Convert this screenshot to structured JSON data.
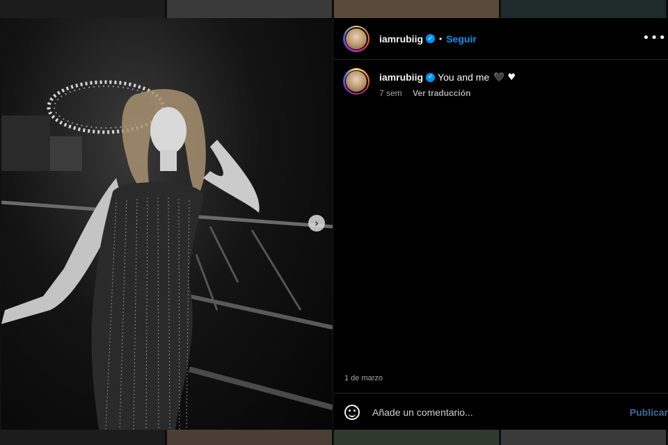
{
  "colors": {
    "accent": "#0095f6",
    "panel_bg": "#000000",
    "muted": "#a8a8a8"
  },
  "post": {
    "username": "iamrubiig",
    "separator": "•",
    "follow_label": "Seguir",
    "more_icon": "more-horizontal-icon",
    "verified_icon": "verified-badge-icon",
    "next_icon": "chevron-right-icon"
  },
  "caption": {
    "username": "iamrubiig",
    "text": "You and me",
    "emoji_dark": "🖤",
    "emoji_white": "♥",
    "age": "7 sem",
    "translate_label": "Ver traducción"
  },
  "date": "1 de marzo",
  "comment": {
    "placeholder": "Añade un comentario...",
    "publish_label": "Publicar",
    "emoji_icon": "emoji-smiley-icon"
  }
}
